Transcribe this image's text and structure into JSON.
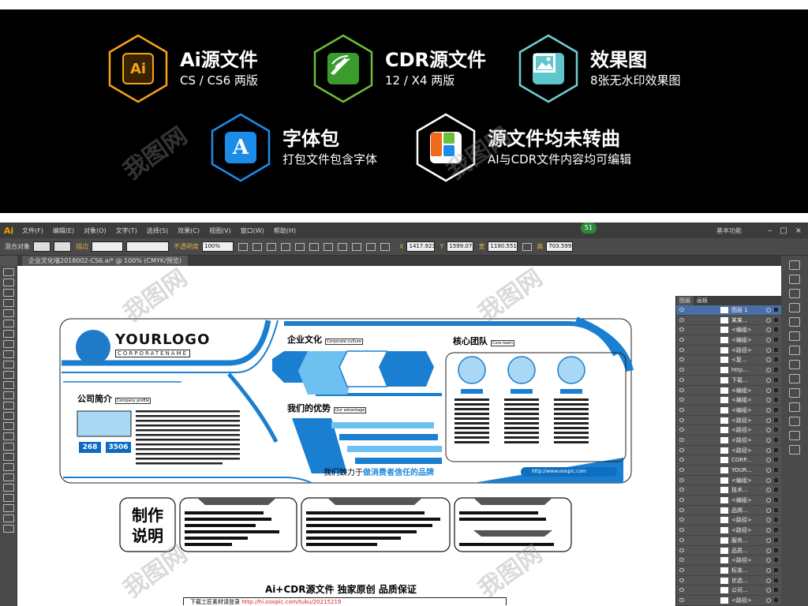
{
  "banner": {
    "features": [
      {
        "title": "Ai源文件",
        "sub": "CS / CS6 两版",
        "icon": "ai-icon",
        "icon_text": "Ai",
        "ring": "#f6a21b"
      },
      {
        "title": "CDR源文件",
        "sub": "12 / X4 两版",
        "icon": "coreldraw-icon",
        "icon_text": "",
        "ring": "#6cbf3a"
      },
      {
        "title": "效果图",
        "sub": "8张无水印效果图",
        "icon": "image-icon",
        "icon_text": "",
        "ring": "#6fd0d4"
      },
      {
        "title": "字体包",
        "sub": "打包文件包含字体",
        "icon": "font-icon",
        "icon_text": "A",
        "ring": "#1b8ce8"
      },
      {
        "title": "源文件均未转曲",
        "sub": "AI与CDR文件内容均可编辑",
        "icon": "layout-icon",
        "icon_text": "",
        "ring": "#ffffff"
      }
    ]
  },
  "app": {
    "logo": "Ai",
    "menus": [
      "文件(F)",
      "编辑(E)",
      "对象(O)",
      "文字(T)",
      "选择(S)",
      "效果(C)",
      "视图(V)",
      "窗口(W)",
      "帮助(H)"
    ],
    "badge": "51",
    "workspace": "基本功能",
    "win_buttons": [
      "–",
      "□",
      "×"
    ],
    "control": {
      "mixed_label": "混合对象",
      "stroke_label": "描边",
      "opacity_label": "不透明度",
      "opacity_value": "100%",
      "x_label": "X",
      "x_value": "1417.923",
      "y_label": "Y",
      "y_value": "1599.07",
      "w_label": "宽",
      "w_value": "1190.551",
      "h_label": "高",
      "h_value": "703.599"
    },
    "doc_tab": "企业文化墙2018002-CS6.ai* @ 100% (CMYK/预览)",
    "layers_tabs": [
      "图层",
      "画板"
    ],
    "layers": [
      "图层 1",
      "某某...",
      "<编组>",
      "<编组>",
      "<路径>",
      "<复...",
      "http...",
      "下载...",
      "<编组>",
      "<编组>",
      "<编组>",
      "<路径>",
      "<路径>",
      "<路径>",
      "<路径>",
      "CORP...",
      "YOUR...",
      "<编组>",
      "技术...",
      "<编组>",
      "品牌...",
      "<路径>",
      "<路径>",
      "服务...",
      "品质...",
      "<路径>",
      "标准...",
      "优选...",
      "公司...",
      "<路径>"
    ]
  },
  "artwork": {
    "logo": "YOURLOGO",
    "logo_sub": "CORPORATENAME",
    "culture": "企业文化",
    "culture_en": "Corporate culture",
    "team": "核心团队",
    "team_en": "Core team",
    "intro": "公司简介",
    "intro_en": "Company profile",
    "advantage": "我们的优势",
    "advantage_en": "Our advantage",
    "stat1": "268",
    "stat2": "3506",
    "slogan_prefix": "我们致力于",
    "slogan_highlight": "做消费者信任的品牌",
    "url": "http://www.ooopic.com",
    "make_title": "制作说明",
    "bottom_title": "Ai+CDR源文件 独家原创 品质保证",
    "bottom_prefix": "下载工匠素材请登录",
    "bottom_link": "http://hi.ooopic.com/tuku/20215219"
  }
}
